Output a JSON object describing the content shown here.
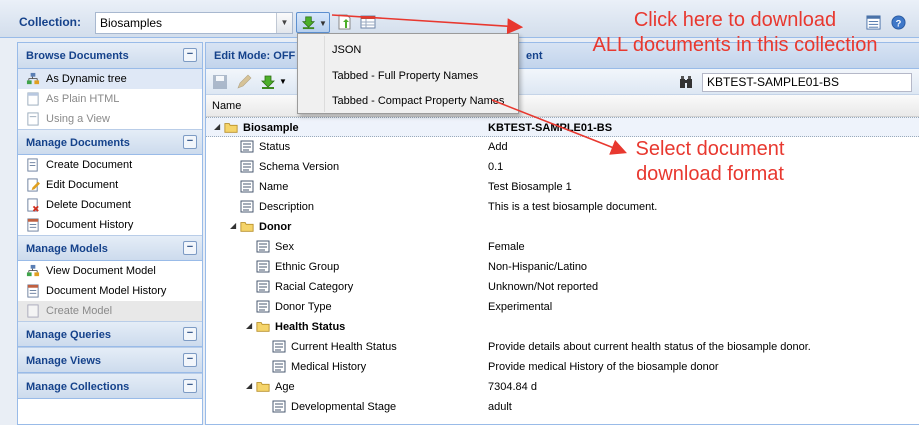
{
  "toolbar": {
    "collection_label": "Collection:",
    "collection_value": "Biosamples"
  },
  "download_menu": {
    "items": [
      "JSON",
      "Tabbed - Full Property Names",
      "Tabbed - Compact Property Names"
    ]
  },
  "annotations": {
    "top_line1": "Click here to download",
    "top_line2": "ALL documents in this collection",
    "mid_line1": "Select document",
    "mid_line2": "download format",
    "color": "#e8382f"
  },
  "sidebar": {
    "sections": [
      {
        "title": "Browse Documents",
        "toggle": "−",
        "items": [
          {
            "label": "As Dynamic tree",
            "icon": "tree-icon",
            "state": "selected"
          },
          {
            "label": "As Plain HTML",
            "icon": "html-icon",
            "state": "disabled"
          },
          {
            "label": "Using a View",
            "icon": "view-icon",
            "state": "disabled"
          }
        ]
      },
      {
        "title": "Manage Documents",
        "toggle": "−",
        "items": [
          {
            "label": "Create Document",
            "icon": "document-add-icon",
            "state": "normal"
          },
          {
            "label": "Edit Document",
            "icon": "document-edit-icon",
            "state": "normal"
          },
          {
            "label": "Delete Document",
            "icon": "document-delete-icon",
            "state": "normal"
          },
          {
            "label": "Document History",
            "icon": "history-icon",
            "state": "normal"
          }
        ]
      },
      {
        "title": "Manage Models",
        "toggle": "−",
        "items": [
          {
            "label": "View Document Model",
            "icon": "tree-icon",
            "state": "normal"
          },
          {
            "label": "Document Model History",
            "icon": "history-icon",
            "state": "normal"
          },
          {
            "label": "Create Model",
            "icon": "model-add-icon",
            "state": "disabled-selected"
          }
        ]
      },
      {
        "title": "Manage Queries",
        "toggle": "−",
        "items": []
      },
      {
        "title": "Manage Views",
        "toggle": "−",
        "items": []
      },
      {
        "title": "Manage Collections",
        "toggle": "−",
        "items": []
      }
    ]
  },
  "main": {
    "title_prefix": "Edit Mode: OFF",
    "title_suffix": "ent",
    "search_value": "KBTEST-SAMPLE01-BS",
    "column_name": "Name",
    "rows": [
      {
        "name": "Biosample",
        "value": "KBTEST-SAMPLE01-BS",
        "level": 0,
        "kind": "folder",
        "bold": true,
        "value_bold": true,
        "highlight": true
      },
      {
        "name": "Status",
        "value": "Add",
        "level": 1,
        "kind": "property"
      },
      {
        "name": "Schema Version",
        "value": "0.1",
        "level": 1,
        "kind": "property"
      },
      {
        "name": "Name",
        "value": "Test Biosample 1",
        "level": 1,
        "kind": "property"
      },
      {
        "name": "Description",
        "value": "This is a test biosample document.",
        "level": 1,
        "kind": "property"
      },
      {
        "name": "Donor",
        "value": "",
        "level": 1,
        "kind": "folder",
        "bold": true
      },
      {
        "name": "Sex",
        "value": "Female",
        "level": 2,
        "kind": "property"
      },
      {
        "name": "Ethnic Group",
        "value": "Non-Hispanic/Latino",
        "level": 2,
        "kind": "property"
      },
      {
        "name": "Racial Category",
        "value": "Unknown/Not reported",
        "level": 2,
        "kind": "property"
      },
      {
        "name": "Donor Type",
        "value": "Experimental",
        "level": 2,
        "kind": "property"
      },
      {
        "name": "Health Status",
        "value": "",
        "level": 2,
        "kind": "folder",
        "bold": true
      },
      {
        "name": "Current Health Status",
        "value": "Provide details about current health status of the biosample donor.",
        "level": 3,
        "kind": "property"
      },
      {
        "name": "Medical History",
        "value": "Provide medical History of the biosample donor",
        "level": 3,
        "kind": "property"
      },
      {
        "name": "Age",
        "value": "7304.84 d",
        "level": 2,
        "kind": "folder"
      },
      {
        "name": "Developmental Stage",
        "value": "adult",
        "level": 3,
        "kind": "property"
      }
    ]
  }
}
